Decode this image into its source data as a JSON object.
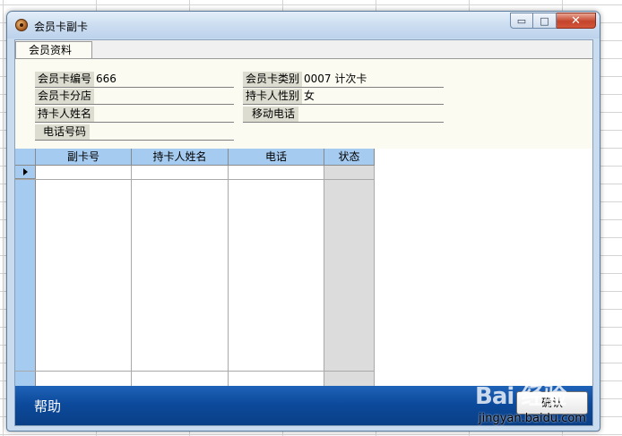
{
  "window": {
    "title": "会员卡副卡",
    "min_glyph": "▭",
    "max_glyph": "□",
    "close_glyph": "✕"
  },
  "tabs": [
    {
      "label": "会员资料",
      "active": true
    }
  ],
  "form": {
    "card_no_label": "会员卡编号",
    "card_no_value": "666",
    "card_type_label": "会员卡类别",
    "card_type_value": "0007  计次卡",
    "branch_label": "会员卡分店",
    "branch_value": "",
    "gender_label": "持卡人性别",
    "gender_value": "女",
    "holder_name_label": "持卡人姓名",
    "holder_name_value": "",
    "mobile_label": "移动电话",
    "mobile_value": "",
    "phone_label": "电话号码",
    "phone_value": ""
  },
  "grid": {
    "columns": [
      "副卡号",
      "持卡人姓名",
      "电话",
      "状态"
    ],
    "rows": []
  },
  "footer": {
    "help_label": "帮助",
    "ok_label": "确认"
  },
  "watermark": {
    "logo_text": "Bai 经验",
    "url_text": "jingyan.baidu.com"
  },
  "colors": {
    "grid_header": "#a6cbf0",
    "footer_bar": "#0c4a9c",
    "label_bg": "#dcdcd0",
    "panel_bg": "#fbfbf1"
  },
  "icons": {
    "app": "app-icon",
    "row_pointer": "row-pointer-icon"
  }
}
